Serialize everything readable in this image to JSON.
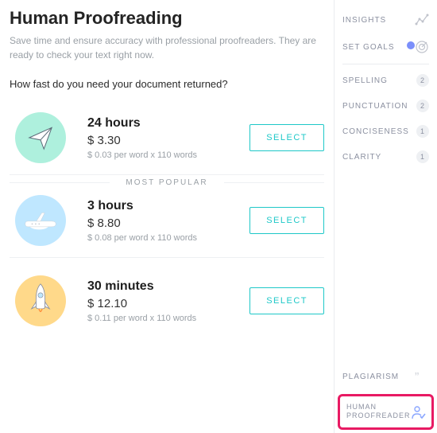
{
  "header": {
    "title": "Human Proofreading",
    "subtitle": "Save time and ensure accuracy with professional proofreaders. They are ready to check your text right now.",
    "question": "How fast do you need your document returned?"
  },
  "tiers": [
    {
      "time": "24 hours",
      "price": "$ 3.30",
      "per": "$ 0.03 per word x 110 words",
      "select": "SELECT"
    },
    {
      "time": "3 hours",
      "price": "$ 8.80",
      "per": "$ 0.08 per word x 110 words",
      "select": "SELECT",
      "tag": "MOST POPULAR"
    },
    {
      "time": "30 minutes",
      "price": "$ 12.10",
      "per": "$ 0.11 per word x 110 words",
      "select": "SELECT"
    }
  ],
  "sidebar": {
    "insights": "INSIGHTS",
    "goals": "SET GOALS",
    "items": [
      {
        "label": "SPELLING",
        "count": "2"
      },
      {
        "label": "PUNCTUATION",
        "count": "2"
      },
      {
        "label": "CONCISENESS",
        "count": "1"
      },
      {
        "label": "CLARITY",
        "count": "1"
      }
    ],
    "plagiarism": "PLAGIARISM",
    "proofreader": "HUMAN PROOFREADER"
  }
}
